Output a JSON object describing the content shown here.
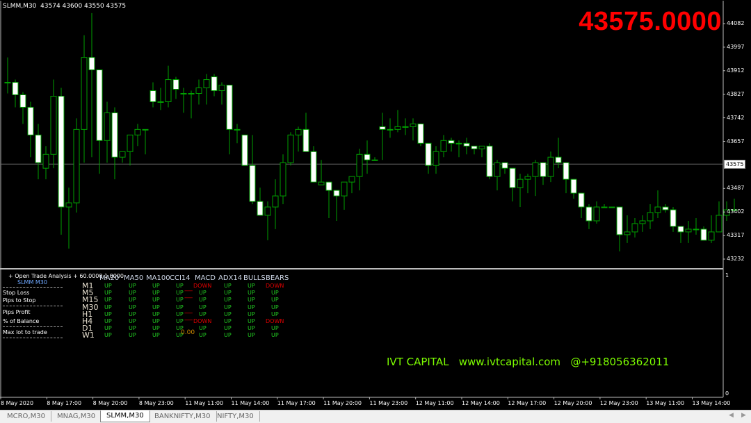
{
  "chart": {
    "symbol_header": "SLMM,M30  43574 43600 43550 43575",
    "big_price": "43575.0000",
    "current_price_tag": "43575",
    "current_price": 43575,
    "price_axis": [
      "44082",
      "43997",
      "43912",
      "43827",
      "43742",
      "43657",
      "43487",
      "43402",
      "43317",
      "43232"
    ],
    "price_axis_values": [
      44082,
      43997,
      43912,
      43827,
      43742,
      43657,
      43487,
      43402,
      43317,
      43232
    ],
    "indicator_axis": {
      "top": "1",
      "bottom": "0"
    },
    "time_axis": [
      "8 May 2020",
      "8 May 17:00",
      "8 May 20:00",
      "8 May 23:00",
      "11 May 11:00",
      "11 May 14:00",
      "11 May 17:00",
      "11 May 20:00",
      "11 May 23:00",
      "12 May 11:00",
      "12 May 14:00",
      "12 May 17:00",
      "12 May 20:00",
      "12 May 23:00",
      "13 May 11:00",
      "13 May 14:00"
    ],
    "colors": {
      "bull_body": "#000000",
      "bear_body": "#ffffff",
      "wick": "#00a000",
      "big_price": "#ff0000",
      "brand": "#7cfc00",
      "up": "#22cc22",
      "down": "#e00000"
    },
    "candles": [
      [
        43870,
        43960,
        43830,
        43870
      ],
      [
        43870,
        43880,
        43780,
        43825
      ],
      [
        43825,
        43835,
        43720,
        43780
      ],
      [
        43780,
        43800,
        43600,
        43680
      ],
      [
        43680,
        43720,
        43520,
        43580
      ],
      [
        43560,
        43640,
        43520,
        43610
      ],
      [
        43610,
        43880,
        43560,
        43820
      ],
      [
        43820,
        43850,
        43320,
        43420
      ],
      [
        43420,
        43490,
        43270,
        43435
      ],
      [
        43435,
        43740,
        43400,
        43700
      ],
      [
        43700,
        44040,
        43580,
        43960
      ],
      [
        43960,
        44120,
        43600,
        43915
      ],
      [
        43915,
        43860,
        43540,
        43660
      ],
      [
        43660,
        43800,
        43580,
        43760
      ],
      [
        43760,
        43780,
        43520,
        43600
      ],
      [
        43600,
        43620,
        43580,
        43620
      ],
      [
        43620,
        43680,
        43570,
        43680
      ],
      [
        43680,
        43720,
        43640,
        43700
      ],
      [
        43700,
        43670,
        43610,
        43700
      ],
      [
        43840,
        43870,
        43780,
        43800
      ],
      [
        43800,
        43850,
        43770,
        43800
      ],
      [
        43800,
        43930,
        43780,
        43880
      ],
      [
        43880,
        43890,
        43810,
        43845
      ],
      [
        43830,
        43850,
        43760,
        43830
      ],
      [
        43830,
        43840,
        43740,
        43830
      ],
      [
        43830,
        43880,
        43790,
        43850
      ],
      [
        43850,
        43900,
        43790,
        43880
      ],
      [
        43890,
        43900,
        43820,
        43840
      ],
      [
        43840,
        43870,
        43790,
        43860
      ],
      [
        43860,
        43860,
        43610,
        43700
      ],
      [
        43700,
        43720,
        43650,
        43700
      ],
      [
        43680,
        43660,
        43570,
        43570
      ],
      [
        43570,
        43680,
        43430,
        43440
      ],
      [
        43440,
        43490,
        43390,
        43390
      ],
      [
        43390,
        43440,
        43300,
        43420
      ],
      [
        43420,
        43520,
        43340,
        43460
      ],
      [
        43460,
        43610,
        43430,
        43580
      ],
      [
        43580,
        43690,
        43570,
        43680
      ],
      [
        43680,
        43710,
        43620,
        43700
      ],
      [
        43700,
        43760,
        43620,
        43620
      ],
      [
        43620,
        43640,
        43510,
        43510
      ],
      [
        43500,
        43590,
        43500,
        43510
      ],
      [
        43510,
        43500,
        43380,
        43480
      ],
      [
        43480,
        43460,
        43370,
        43460
      ],
      [
        43460,
        43510,
        43410,
        43510
      ],
      [
        43510,
        43520,
        43470,
        43530
      ],
      [
        43530,
        43630,
        43480,
        43610
      ],
      [
        43610,
        43660,
        43540,
        43590
      ],
      [
        43590,
        43600,
        43590,
        43590
      ],
      [
        43710,
        43760,
        43590,
        43700
      ],
      [
        43700,
        43740,
        43670,
        43700
      ],
      [
        43700,
        43770,
        43690,
        43710
      ],
      [
        43710,
        43740,
        43680,
        43710
      ],
      [
        43710,
        43740,
        43660,
        43720
      ],
      [
        43720,
        43700,
        43640,
        43650
      ],
      [
        43650,
        43620,
        43540,
        43570
      ],
      [
        43570,
        43640,
        43540,
        43620
      ],
      [
        43620,
        43680,
        43600,
        43660
      ],
      [
        43660,
        43670,
        43620,
        43650
      ],
      [
        43650,
        43660,
        43600,
        43650
      ],
      [
        43650,
        43670,
        43610,
        43640
      ],
      [
        43640,
        43640,
        43610,
        43630
      ],
      [
        43630,
        43640,
        43600,
        43640
      ],
      [
        43640,
        43650,
        43520,
        43530
      ],
      [
        43530,
        43590,
        43480,
        43580
      ],
      [
        43580,
        43570,
        43540,
        43560
      ],
      [
        43560,
        43530,
        43440,
        43490
      ],
      [
        43490,
        43540,
        43420,
        43520
      ],
      [
        43520,
        43540,
        43470,
        43530
      ],
      [
        43530,
        43590,
        43460,
        43580
      ],
      [
        43580,
        43580,
        43500,
        43530
      ],
      [
        43530,
        43620,
        43510,
        43600
      ],
      [
        43600,
        43670,
        43560,
        43580
      ],
      [
        43580,
        43580,
        43470,
        43520
      ],
      [
        43520,
        43520,
        43450,
        43470
      ],
      [
        43470,
        43470,
        43380,
        43420
      ],
      [
        43420,
        43430,
        43340,
        43370
      ],
      [
        43370,
        43440,
        43360,
        43420
      ],
      [
        43420,
        43430,
        43420,
        43420
      ],
      [
        43420,
        43420,
        43420,
        43420
      ],
      [
        43420,
        43420,
        43260,
        43320
      ],
      [
        43320,
        43390,
        43290,
        43330
      ],
      [
        43330,
        43380,
        43310,
        43360
      ],
      [
        43360,
        43390,
        43330,
        43370
      ],
      [
        43370,
        43430,
        43340,
        43400
      ],
      [
        43400,
        43480,
        43380,
        43420
      ],
      [
        43420,
        43430,
        43400,
        43410
      ],
      [
        43410,
        43420,
        43330,
        43350
      ],
      [
        43350,
        43340,
        43290,
        43330
      ],
      [
        43330,
        43370,
        43290,
        43340
      ],
      [
        43340,
        43380,
        43320,
        43340
      ],
      [
        43340,
        43350,
        43300,
        43300
      ],
      [
        43300,
        43390,
        43290,
        43330
      ],
      [
        43330,
        43440,
        43330,
        43390
      ],
      [
        43390,
        43440,
        43370,
        43410
      ],
      [
        43410,
        43450,
        43400,
        43410
      ]
    ]
  },
  "panel": {
    "title": "+ Open Trade Analysis + 60.0000 1.0000",
    "symbol": "SLMM  M30",
    "labels": [
      "Stop Loss",
      "Pips to Stop",
      "Pips Profit",
      "% of Balance",
      "Max lot to trade"
    ],
    "columns": [
      "MA20",
      "MA50",
      "MA100",
      "CCI14",
      "MACD",
      "ADX14",
      "BULLS",
      "BEARS"
    ],
    "timeframes": [
      "M1",
      "M5",
      "M15",
      "M30",
      "H1",
      "H4",
      "D1",
      "W1"
    ],
    "signals": [
      [
        "UP",
        "UP",
        "UP",
        "UP",
        "DOWN",
        "UP",
        "UP",
        "DOWN"
      ],
      [
        "UP",
        "UP",
        "UP",
        "UP",
        "UP",
        "UP",
        "UP",
        "UP"
      ],
      [
        "UP",
        "UP",
        "UP",
        "UP",
        "UP",
        "UP",
        "UP",
        "UP"
      ],
      [
        "UP",
        "UP",
        "UP",
        "UP",
        "UP",
        "UP",
        "UP",
        "UP"
      ],
      [
        "UP",
        "UP",
        "UP",
        "UP",
        "UP",
        "UP",
        "UP",
        "UP"
      ],
      [
        "UP",
        "UP",
        "UP",
        "UP",
        "DOWN",
        "UP",
        "UP",
        "DOWN"
      ],
      [
        "UP",
        "UP",
        "UP",
        "UP",
        "UP",
        "UP",
        "UP",
        "UP"
      ],
      [
        "UP",
        "UP",
        "UP",
        "UP",
        "UP",
        "UP",
        "UP",
        "UP"
      ]
    ],
    "overlay_value": "0.00"
  },
  "branding": "IVT CAPITAL   www.ivtcapital.com   @+918056362011",
  "tabs": [
    {
      "label": "MCRO,M30",
      "active": false
    },
    {
      "label": "MNAG,M30",
      "active": false
    },
    {
      "label": "SLMM,M30",
      "active": true
    },
    {
      "label": "BANKNIFTY,M30",
      "active": false
    },
    {
      "label": "NIFTY,M30",
      "active": false
    }
  ]
}
